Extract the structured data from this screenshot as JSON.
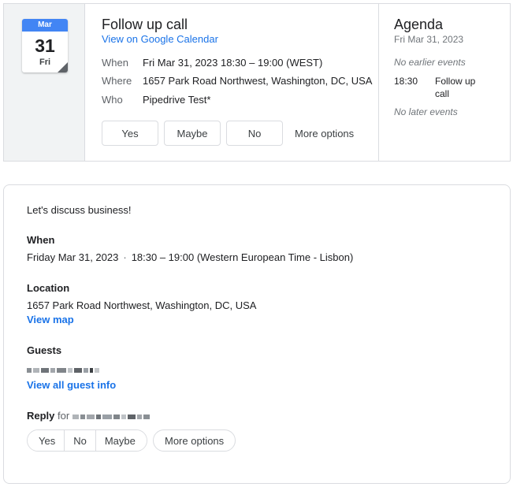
{
  "invite": {
    "calendar_icon": {
      "month": "Mar",
      "day": "31",
      "weekday": "Fri",
      "accent_color": "#4285f4"
    },
    "title": "Follow up call",
    "gcal_link": "View on Google Calendar",
    "details": {
      "when_label": "When",
      "when_value": "Fri Mar 31, 2023 18:30 – 19:00 (WEST)",
      "where_label": "Where",
      "where_value": "1657 Park Road Northwest, Washington, DC, USA",
      "who_label": "Who",
      "who_value": "Pipedrive Test*"
    },
    "rsvp": {
      "yes": "Yes",
      "maybe": "Maybe",
      "no": "No",
      "more": "More options"
    }
  },
  "agenda": {
    "title": "Agenda",
    "date": "Fri Mar 31, 2023",
    "earlier": "No earlier events",
    "event_time": "18:30",
    "event_title": "Follow up call",
    "later": "No later events"
  },
  "details": {
    "description": "Let's discuss business!",
    "when_heading": "When",
    "when_date": "Friday Mar 31, 2023",
    "separator": "·",
    "when_time": "18:30 – 19:00 (Western European Time - Lisbon)",
    "location_heading": "Location",
    "location_value": "1657 Park Road Northwest, Washington, DC, USA",
    "view_map": "View map",
    "guests_heading": "Guests",
    "view_guests": "View all guest info",
    "reply_label": "Reply",
    "reply_for": "for",
    "reply_buttons": {
      "yes": "Yes",
      "no": "No",
      "maybe": "Maybe",
      "more": "More options"
    }
  },
  "colors": {
    "link": "#1a73e8",
    "border": "#dadce0",
    "muted": "#5f6368"
  }
}
